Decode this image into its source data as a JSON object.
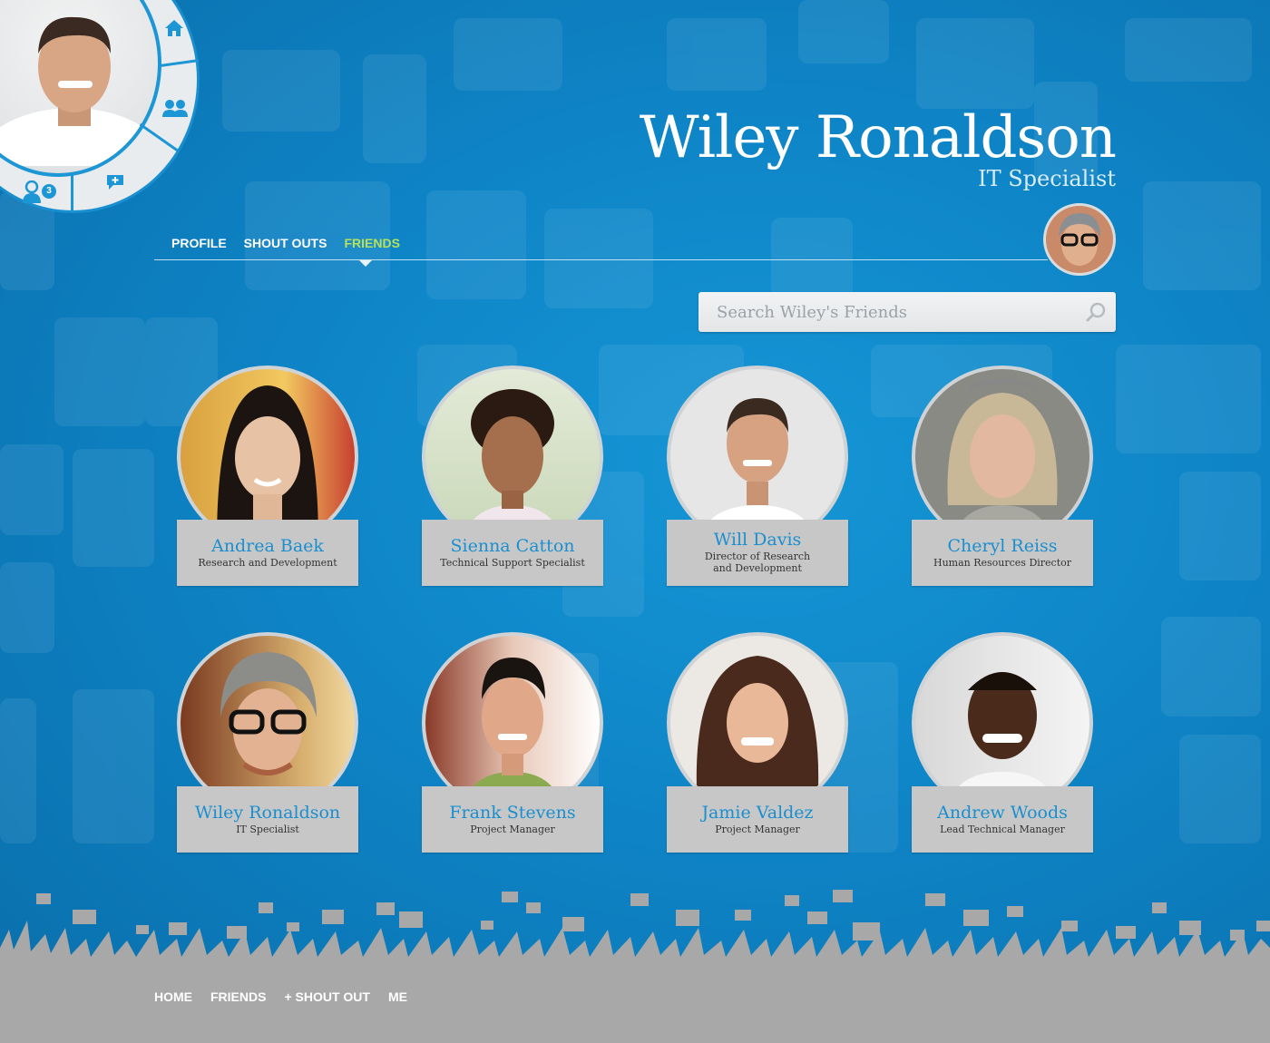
{
  "profile": {
    "name": "Wiley Ronaldson",
    "title": "IT Specialist"
  },
  "menu": {
    "notification_count": "3"
  },
  "tabs": [
    {
      "label": "PROFILE",
      "active": false
    },
    {
      "label": "SHOUT OUTS",
      "active": false
    },
    {
      "label": "FRIENDS",
      "active": true
    }
  ],
  "search": {
    "placeholder": "Search Wiley's Friends"
  },
  "friends": [
    {
      "name": "Andrea Baek",
      "role": "Research and Development"
    },
    {
      "name": "Sienna Catton",
      "role": "Technical Support Specialist"
    },
    {
      "name": "Will Davis",
      "role": "Director of Research\nand Development"
    },
    {
      "name": "Cheryl Reiss",
      "role": "Human Resources Director"
    },
    {
      "name": "Wiley Ronaldson",
      "role": "IT Specialist"
    },
    {
      "name": "Frank Stevens",
      "role": "Project Manager"
    },
    {
      "name": "Jamie Valdez",
      "role": "Project Manager"
    },
    {
      "name": "Andrew Woods",
      "role": "Lead Technical Manager"
    }
  ],
  "footer_nav": [
    "HOME",
    "FRIENDS",
    "+ SHOUT OUT",
    "ME"
  ],
  "colors": {
    "accent_blue": "#1a8fd0",
    "active_tab": "#b6e25a",
    "card_bg": "#c7c7c7",
    "footer_bg": "#a8a8a8"
  }
}
